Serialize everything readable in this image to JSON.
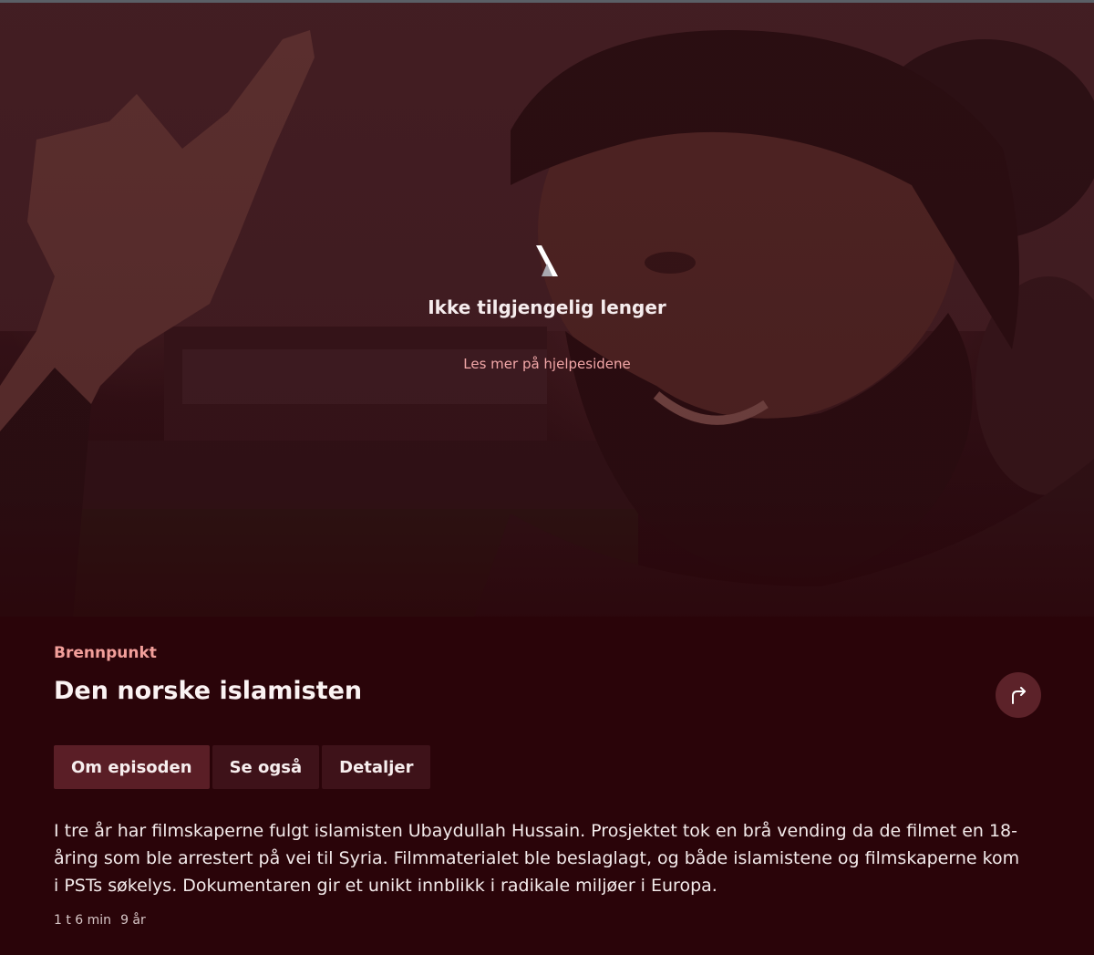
{
  "player": {
    "status_title": "Ikke tilgjengelig lenger",
    "help_link": "Les mer på hjelpesidene",
    "logo_icon": "nrk-tv-logo-icon"
  },
  "program": {
    "series_name": "Brennpunkt",
    "episode_title": "Den norske islamisten",
    "share_icon": "share-arrow-icon"
  },
  "tabs": [
    {
      "label": "Om episoden",
      "active": true
    },
    {
      "label": "Se også",
      "active": false
    },
    {
      "label": "Detaljer",
      "active": false
    }
  ],
  "description": "I tre år har filmskaperne fulgt islamisten Ubaydullah Hussain. Prosjektet tok en brå vending da de filmet en 18-åring som ble arrestert på vei til Syria. Filmmaterialet ble beslaglagt, og både islamistene og filmskaperne kom i PSTs søkelys. Dokumentaren gir et unikt innblikk i radikale miljøer i Europa.",
  "meta": {
    "duration": "1 t 6 min",
    "age": "9 år"
  },
  "colors": {
    "background": "#2a0409",
    "accent": "#f29f9a",
    "tab_active": "#5a1e26",
    "tab_inactive": "#3e1219"
  }
}
